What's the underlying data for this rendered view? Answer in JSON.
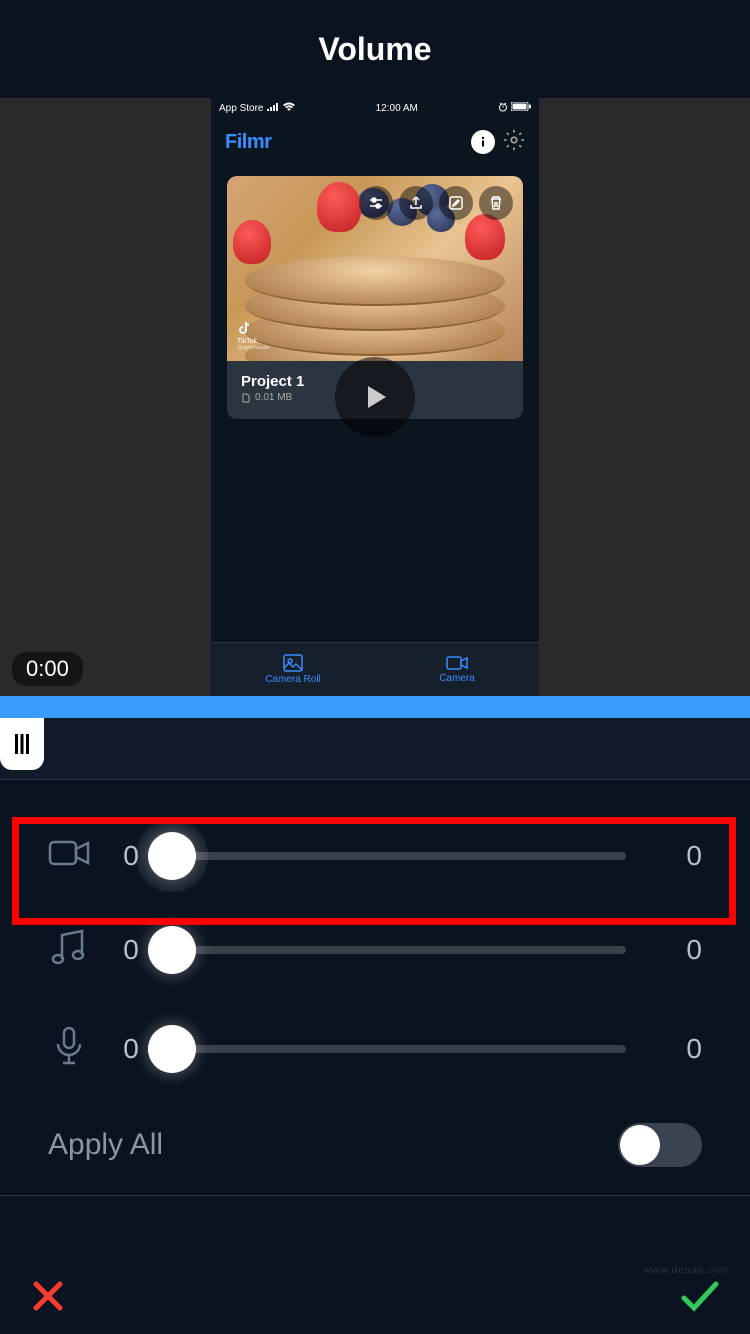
{
  "header": {
    "title": "Volume"
  },
  "preview": {
    "statusbar": {
      "back": "App Store",
      "time": "12:00 AM"
    },
    "app_name": "Filmr",
    "project": {
      "name": "Project 1",
      "size": "0.01 MB"
    },
    "tabs": {
      "camera_roll": "Camera Roll",
      "camera": "Camera"
    },
    "time_badge": "0:00"
  },
  "sliders": {
    "video": {
      "left": "0",
      "right": "0"
    },
    "music": {
      "left": "0",
      "right": "0"
    },
    "mic": {
      "left": "0",
      "right": "0"
    }
  },
  "apply_all": {
    "label": "Apply All"
  },
  "watermark": "www.deuaq.com"
}
